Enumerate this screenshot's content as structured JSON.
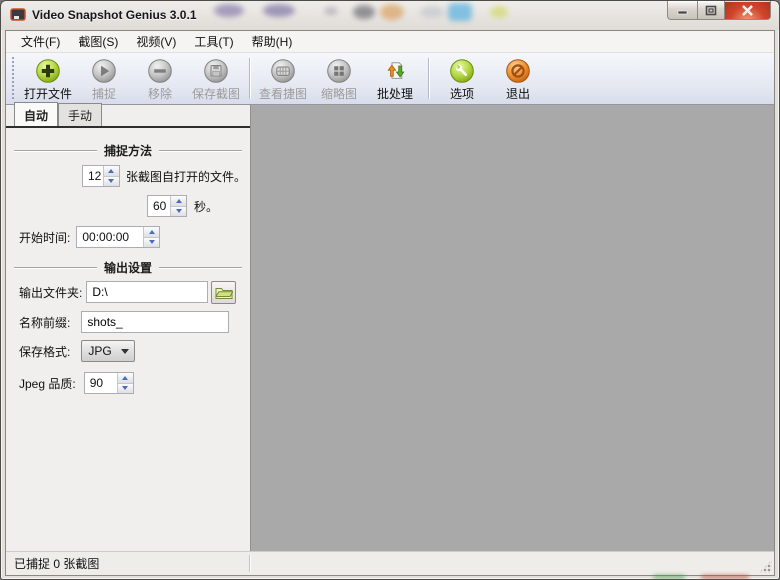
{
  "window": {
    "title": "Video Snapshot Genius 3.0.1",
    "controls": {
      "minimize": "minimize",
      "maximize": "maximize",
      "close": "close"
    }
  },
  "menu": {
    "items": [
      {
        "label": "文件(F)"
      },
      {
        "label": "截图(S)"
      },
      {
        "label": "视频(V)"
      },
      {
        "label": "工具(T)"
      },
      {
        "label": "帮助(H)"
      }
    ]
  },
  "toolbar": {
    "buttons": [
      {
        "label": "打开文件",
        "icon": "open-file-icon",
        "enabled": true
      },
      {
        "label": "捕捉",
        "icon": "capture-icon",
        "enabled": false
      },
      {
        "label": "移除",
        "icon": "remove-icon",
        "enabled": false
      },
      {
        "label": "保存截图",
        "icon": "save-snapshot-icon",
        "enabled": false
      },
      {
        "label": "查看捷图",
        "icon": "view-snapshots-icon",
        "enabled": false
      },
      {
        "label": "缩略图",
        "icon": "thumbnails-icon",
        "enabled": false
      },
      {
        "label": "批处理",
        "icon": "batch-process-icon",
        "enabled": true
      },
      {
        "label": "选项",
        "icon": "options-icon",
        "enabled": true
      },
      {
        "label": "退出",
        "icon": "exit-icon",
        "enabled": true
      }
    ]
  },
  "tabs": [
    {
      "label": "自动",
      "active": true
    },
    {
      "label": "手动",
      "active": false
    }
  ],
  "panel": {
    "capture_section_title": "捕捉方法",
    "frames_value": "12",
    "frames_label": "张截图自打开的文件。",
    "interval_value": "60",
    "interval_label": "秒。",
    "start_time_label": "开始时间:",
    "start_time_value": "00:00:00",
    "output_section_title": "输出设置",
    "output_folder_label": "输出文件夹:",
    "output_folder_value": "D:\\",
    "prefix_label": "名称前缀:",
    "prefix_value": "shots_",
    "format_label": "保存格式:",
    "format_value": "JPG",
    "quality_label": "Jpeg 品质:",
    "quality_value": "90"
  },
  "statusbar": {
    "text": "已捕捉 0 张截图"
  },
  "colors": {
    "accent_lime": "#A9CE34",
    "accent_orange": "#EE8E2B",
    "main_area_gray": "#A9A9A9",
    "toolbar_tint": "#E3E7F1",
    "close_button_red": "#C43A20"
  }
}
